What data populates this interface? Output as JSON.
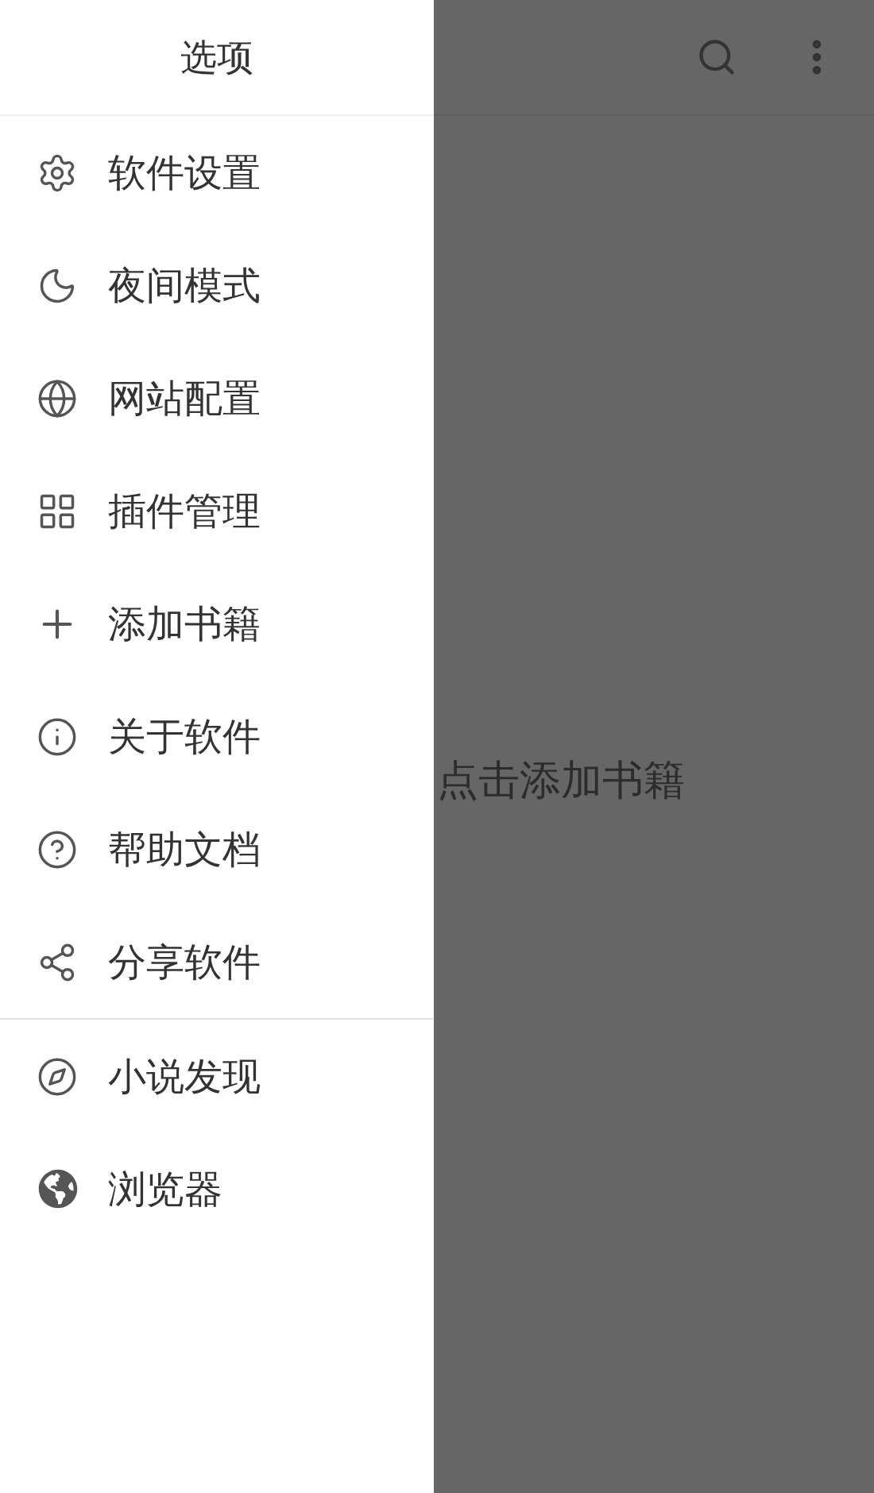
{
  "main": {
    "empty_hint": "点击添加书籍"
  },
  "drawer": {
    "title": "选项",
    "groups": [
      {
        "items": [
          {
            "label": "软件设置"
          },
          {
            "label": "夜间模式"
          },
          {
            "label": "网站配置"
          },
          {
            "label": "插件管理"
          },
          {
            "label": "添加书籍"
          },
          {
            "label": "关于软件"
          },
          {
            "label": "帮助文档"
          },
          {
            "label": "分享软件"
          }
        ]
      },
      {
        "items": [
          {
            "label": "小说发现"
          },
          {
            "label": "浏览器"
          }
        ]
      }
    ]
  }
}
